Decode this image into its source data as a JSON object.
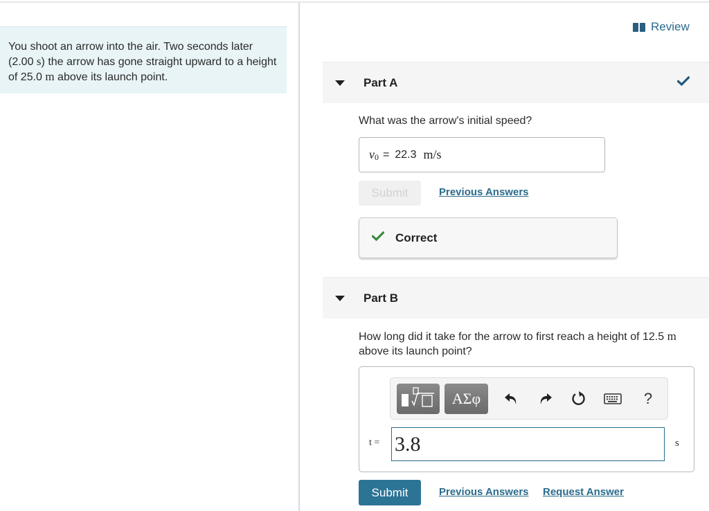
{
  "problem": {
    "text_parts": [
      {
        "text": "You shoot an arrow into the air. Two seconds later (2.00 ",
        "math": false
      },
      {
        "text": "s",
        "math": true
      },
      {
        "text": ") the arrow has gone straight upward to a height of 25.0 ",
        "math": false
      },
      {
        "text": "m",
        "math": true
      },
      {
        "text": " above its launch point.",
        "math": false
      }
    ]
  },
  "header": {
    "review_label": "Review",
    "review_icon": "book-icon"
  },
  "part_a": {
    "title": "Part A",
    "status_icon": "checkmark-icon",
    "question": "What was the arrow's initial speed?",
    "answer": {
      "variable": "v",
      "subscript": "0",
      "equals": "=",
      "value": "22.3",
      "units": "m/s"
    },
    "submit_label": "Submit",
    "submit_enabled": false,
    "previous_answers_label": "Previous Answers",
    "feedback": {
      "icon": "checkmark-icon",
      "text": "Correct",
      "color": "#3a8a3e"
    }
  },
  "part_b": {
    "title": "Part B",
    "question_text": "How long did it take for the arrow to first reach a height of 12.5 ",
    "question_unit": "m",
    "question_text_end": " above its launch point?",
    "toolbar": {
      "template_button": "templates-icon",
      "greek_button_label": "ΑΣφ",
      "undo": "undo-icon",
      "redo": "redo-icon",
      "reset": "reset-icon",
      "keyboard": "keyboard-icon",
      "help_label": "?"
    },
    "input": {
      "label": "t =",
      "value": "3.8",
      "units": "s"
    },
    "submit_label": "Submit",
    "previous_answers_label": "Previous Answers",
    "request_answer_label": "Request Answer"
  },
  "colors": {
    "accent": "#2c7496",
    "link": "#2a6b8c",
    "problem_bg": "#e9f4f7",
    "part_header_bg": "#f5f5f5",
    "correct_green": "#3a8a3e"
  }
}
